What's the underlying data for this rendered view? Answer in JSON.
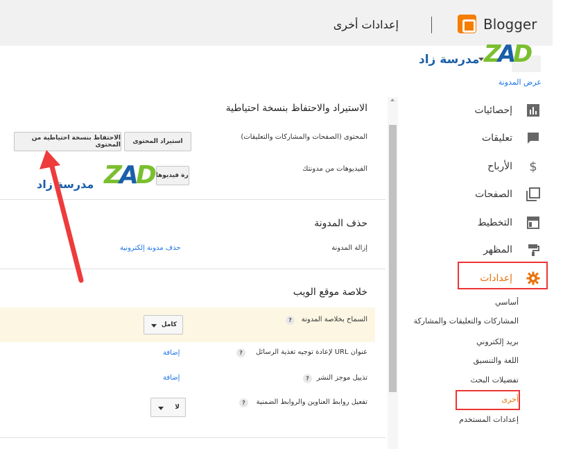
{
  "app": {
    "brand": "Blogger",
    "page_heading": "إعدادات أخرى",
    "view_blog": "عرض المدونة"
  },
  "blog_logo": {
    "mark_z": "Z",
    "mark_a": "A",
    "mark_d": "D",
    "name": "مدرسة زاد"
  },
  "watermark": {
    "mark_z": "Z",
    "mark_a": "A",
    "mark_d": "D",
    "name": "مدرسة زاد"
  },
  "sidebar": {
    "items": [
      {
        "label": "إحصائيات",
        "icon": "bar-chart-icon"
      },
      {
        "label": "تعليقات",
        "icon": "comment-icon"
      },
      {
        "label": "الأرباح",
        "icon": "dollar-icon"
      },
      {
        "label": "الصفحات",
        "icon": "pages-icon"
      },
      {
        "label": "التخطيط",
        "icon": "layout-icon"
      },
      {
        "label": "المظهر",
        "icon": "paint-roller-icon"
      },
      {
        "label": "إعدادات",
        "icon": "gear-icon"
      }
    ],
    "sub_items": [
      {
        "label": "أساسي"
      },
      {
        "label": "المشاركات والتعليقات والمشاركة"
      },
      {
        "label": "بريد إلكتروني"
      },
      {
        "label": "اللغة والتنسيق"
      },
      {
        "label": "تفضيلات البحث"
      },
      {
        "label": "أخرى"
      },
      {
        "label": "إعدادات المستخدم"
      }
    ],
    "accent_color": "#e8710a",
    "annotation_color": "#ee3333"
  },
  "main": {
    "backup_section": {
      "title": "الاستيراد والاحتفاظ بنسخة احتياطية",
      "content_label": "المحتوى (الصفحات والمشاركات والتعليقات)",
      "import_button": "استيراد المحتوى",
      "backup_button": "الاحتفاظ بنسخة احتياطية من المحتوى",
      "videos_label": "الفيديوهات من مدونتك",
      "manage_button": "إدارة فيديوهات"
    },
    "delete_section": {
      "title": "حذف المدونة",
      "remove_label": "إزالة المدونة",
      "delete_link": "حذف مدونة إلكترونية"
    },
    "feed_section": {
      "title": "خلاصة موقع الويب",
      "allow_feed_label": "السماح بخلاصة المدونة",
      "allow_feed_value": "كامل",
      "redirect_label": "عنوان URL لإعادة توجيه تغذية الرسائل",
      "redirect_link": "إضافة",
      "footer_label": "تذييل موجز النشر",
      "footer_link": "إضافة",
      "enclosure_label": "تفعيل روابط العناوين والروابط الضمنية",
      "enclosure_value": "لا",
      "help_glyph": "?"
    }
  }
}
